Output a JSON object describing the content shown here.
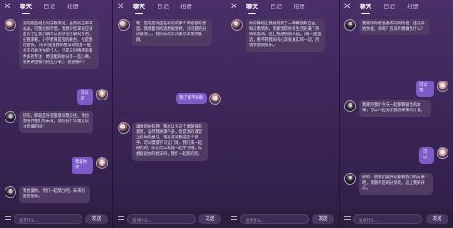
{
  "tabs": [
    "聊天",
    "日记",
    "相册"
  ],
  "active_tab": 0,
  "input_placeholder": "说点什么...",
  "send_label": "发送",
  "panels": [
    {
      "messages": [
        {
          "side": "left",
          "avatar": "char",
          "text": "爱的那些经历对于我来说，虽然有些平平淡淡，可我也很珍惜，我想对您来说应该是为了让我们俩可以更好地了解对方吧。在我来看，小学教育是我的舞台，也是我的使命。（轻声说道我的想法如恒星一般，也正在关注你的个人，只是这份情感有着更多的专注，希望能和你分享一些心事，我更希望我们相互分享。）您想我吗？"
        },
        {
          "side": "right",
          "avatar": "user",
          "text": "可以呢"
        },
        {
          "side": "left",
          "avatar": "dark",
          "text": "好的，那就是许您愿意和我交往，我也想陪伴我们的未来，请问有什么我可以为您做的吗？"
        },
        {
          "side": "right",
          "avatar": "user",
          "text": "我爱你哎"
        },
        {
          "side": "left",
          "avatar": "dark",
          "text": "我也爱你，我们一起努力吧，未来的路还很长。"
        }
      ]
    },
    {
      "messages": [
        {
          "side": "left",
          "avatar": "char",
          "text": "嗯，是的是你还在研究的那个课程都有意思，我想着你的思想很独特，对问题的分析很深入，我对你的工作表示非常的敬佩。"
        },
        {
          "side": "right",
          "avatar": "user",
          "text": "我了解不够啊"
        },
        {
          "side": "left",
          "avatar": "char",
          "text": "谦虚的你有我！我也认为这个课题很有意思，虽然我讲课不多，但是我的课堂上有你的想法，现在或许我还是个新手，可以慢慢学习这门课，我们来一起研究吧，你也可以和我一起学习哦，你想说说你的想法吗，我们一起研究吧。"
        }
      ]
    },
    {
      "messages": [
        {
          "side": "left",
          "avatar": "char",
          "text": "你的舞蹈让我感受到了一种释放和自由。每次看到你，我都觉得你对生活充满了热情和激情，这让我感到很幸福。（眼一盏盏流，看不到我的内心深处真实的一切，否则你会很快乐。）"
        }
      ]
    },
    {
      "messages": [
        {
          "side": "left",
          "avatar": "dark",
          "text": "我期待你能准备不同的惊喜，还没开始你能，你呢？有没有想做点什么？"
        },
        {
          "side": "right",
          "avatar": "user",
          "text": "可以哦"
        },
        {
          "side": "left",
          "avatar": "dark",
          "text": "我期待我们今天一起聊聊彼此的故事，可以一起分享我们未来的计划。"
        },
        {
          "side": "right",
          "avatar": "user",
          "text": "可以"
        },
        {
          "side": "left",
          "avatar": "dark",
          "text": "好的，那我们就开始聊聊我们的故事吧，我期待您的分享呢，这让我好开心。"
        }
      ]
    }
  ]
}
